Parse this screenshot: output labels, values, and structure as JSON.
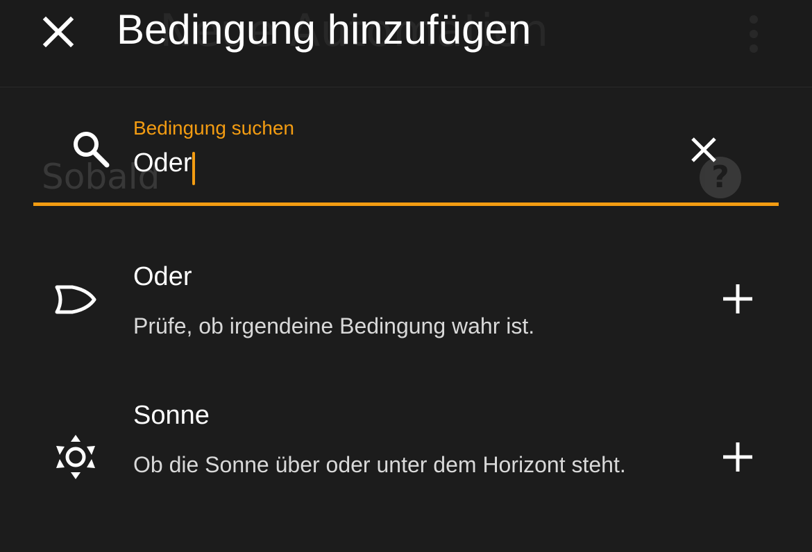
{
  "dialog": {
    "title": "Bedingung hinzufügen",
    "close_icon": "close-icon"
  },
  "search": {
    "label": "Bedingung suchen",
    "value": "Oder",
    "search_icon": "search-icon",
    "clear_icon": "clear-icon"
  },
  "results": [
    {
      "title": "Oder",
      "description": "Prüfe, ob irgendeine Bedingung wahr ist.",
      "icon": "or-gate-icon",
      "action_icon": "plus-icon"
    },
    {
      "title": "Sonne",
      "description": "Ob die Sonne über oder unter dem Horizont steht.",
      "icon": "sun-icon",
      "action_icon": "plus-icon"
    }
  ],
  "background": {
    "title": "Neue Automation",
    "heading": "Sobald",
    "help_icon": "help-icon",
    "menu_icon": "more-vert-icon"
  },
  "colors": {
    "accent": "#f39c12",
    "background": "#1c1c1c",
    "text": "#ffffff",
    "secondary_text": "#d9d9d9"
  }
}
